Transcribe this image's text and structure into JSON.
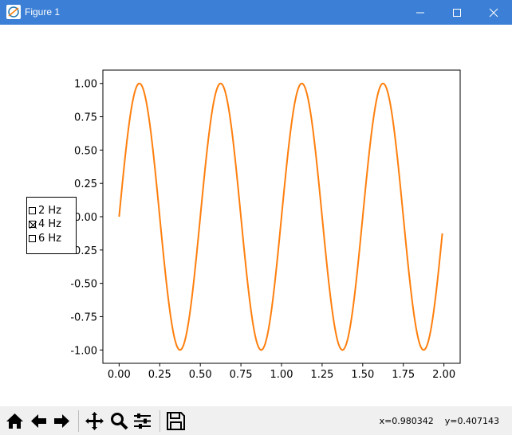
{
  "window": {
    "title": "Figure 1"
  },
  "status": {
    "coords": "x=0.980342    y=0.407143"
  },
  "legend": {
    "items": [
      {
        "label": "2 Hz",
        "checked": false
      },
      {
        "label": "4 Hz",
        "checked": true
      },
      {
        "label": "6 Hz",
        "checked": false
      }
    ]
  },
  "toolbar": {
    "buttons": [
      "home-icon",
      "back-arrow-icon",
      "forward-arrow-icon",
      "pan-icon",
      "zoom-icon",
      "configure-subplots-icon",
      "save-icon"
    ]
  },
  "chart_data": {
    "type": "line",
    "x_range": [
      0,
      2
    ],
    "xlim": [
      -0.1,
      2.1
    ],
    "ylim": [
      -1.1,
      1.1
    ],
    "xticks": [
      "0.00",
      "0.25",
      "0.50",
      "0.75",
      "1.00",
      "1.25",
      "1.50",
      "1.75",
      "2.00"
    ],
    "yticks": [
      "-1.00",
      "-0.75",
      "-0.50",
      "-0.25",
      "0.00",
      "0.25",
      "0.50",
      "0.75",
      "1.00"
    ],
    "series": [
      {
        "frequency_hz": 2,
        "color": "#ff7f0e",
        "visible": true,
        "x_max": 1.99
      }
    ],
    "grid": false
  }
}
